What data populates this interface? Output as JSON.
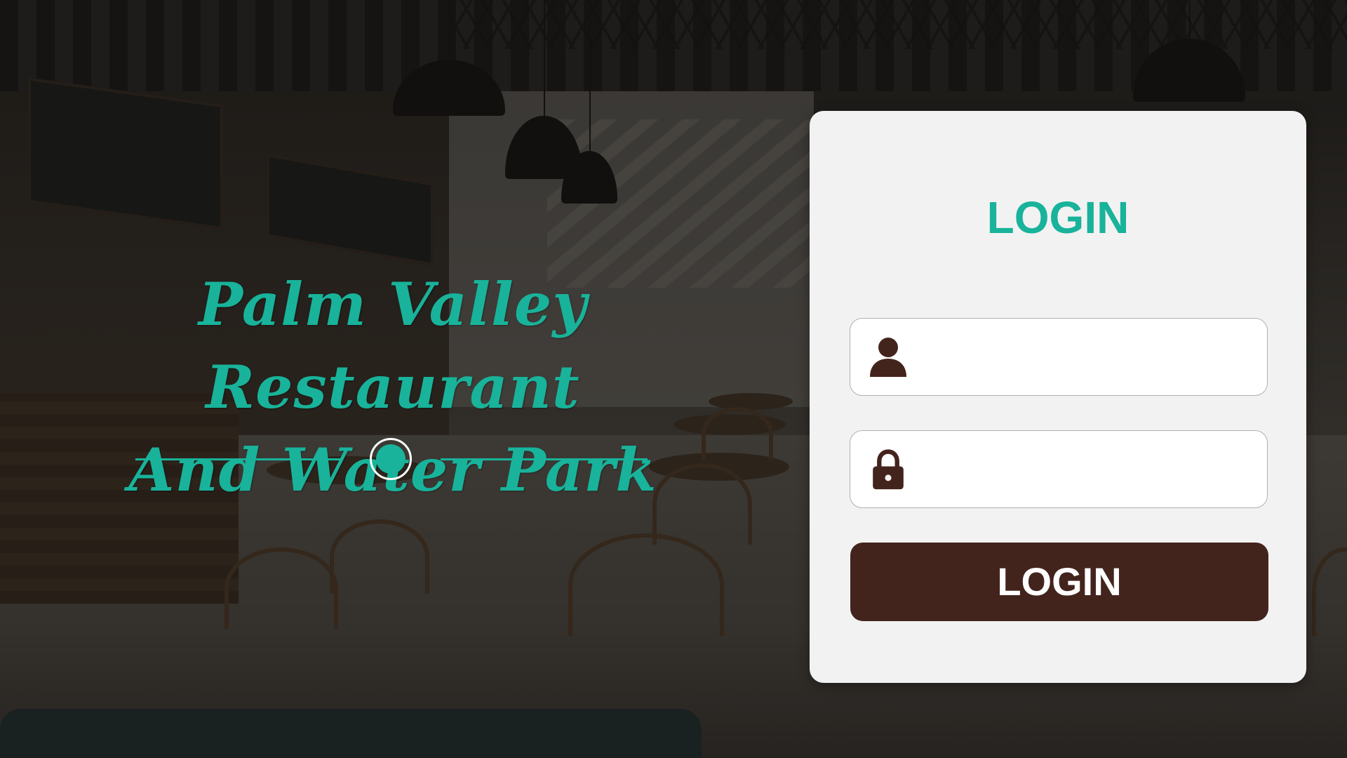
{
  "brand": {
    "title_line1": "Palm Valley Restaurant",
    "title_line2": "And Water Park",
    "accent_color": "#18b39a"
  },
  "login": {
    "heading": "LOGIN",
    "username": {
      "icon": "user-icon",
      "value": "",
      "placeholder": ""
    },
    "password": {
      "icon": "lock-icon",
      "value": "",
      "placeholder": ""
    },
    "button_label": "LOGIN",
    "button_color": "#43241c",
    "card_color": "#f2f2f2"
  }
}
